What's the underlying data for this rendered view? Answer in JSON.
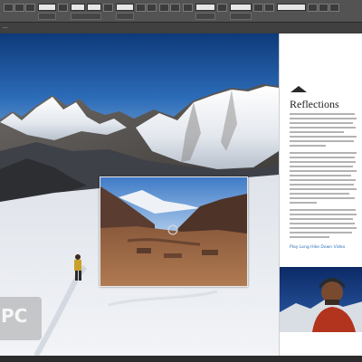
{
  "app": {
    "document_tab": "...",
    "watermark": "PC"
  },
  "article": {
    "title": "Reflections",
    "video_link": "Play Long Hike Down Video"
  },
  "icons": [
    "triangle-logo-icon"
  ],
  "colors": {
    "control_bar": "#535353",
    "link_blue": "#2a6fb8",
    "page_white": "#ffffff"
  }
}
